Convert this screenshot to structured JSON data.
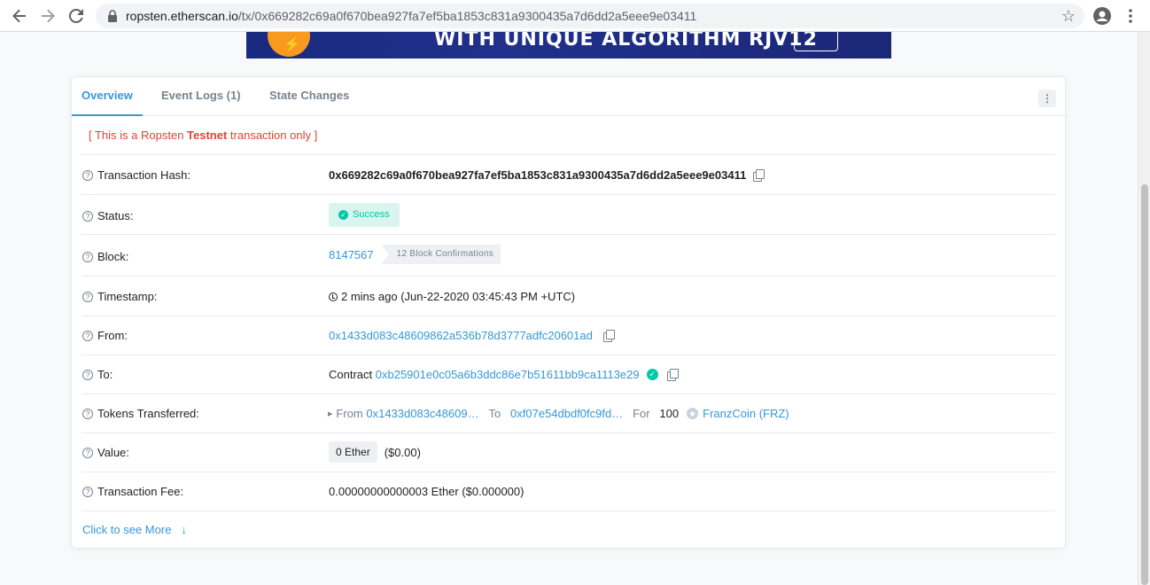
{
  "browser": {
    "url_host": "ropsten.etherscan.io",
    "url_path": "/tx/0x669282c69a0f670bea927fa7ef5ba1853c831a9300435a7d6dd2a5eee9e03411"
  },
  "tabs": [
    {
      "label": "Overview"
    },
    {
      "label": "Event Logs (1)"
    },
    {
      "label": "State Changes"
    }
  ],
  "notice": {
    "prefix": "[ This is a Ropsten ",
    "bold": "Testnet",
    "suffix": " transaction only ]"
  },
  "rows": {
    "tx_hash": {
      "label": "Transaction Hash:",
      "value": "0x669282c69a0f670bea927fa7ef5ba1853c831a9300435a7d6dd2a5eee9e03411"
    },
    "status": {
      "label": "Status:",
      "value": "Success"
    },
    "block": {
      "label": "Block:",
      "value": "8147567",
      "confirmations": "12 Block Confirmations"
    },
    "timestamp": {
      "label": "Timestamp:",
      "value": "2 mins ago (Jun-22-2020 03:45:43 PM +UTC)"
    },
    "from": {
      "label": "From:",
      "value": "0x1433d083c48609862a536b78d3777adfc20601ad"
    },
    "to": {
      "label": "To:",
      "prefix": "Contract",
      "value": "0xb25901e0c05a6b3ddc86e7b51611bb9ca1113e29"
    },
    "tokens": {
      "label": "Tokens Transferred:",
      "from_label": "From",
      "from": "0x1433d083c48609…",
      "to_label": "To",
      "to": "0xf07e54dbdf0fc9fd…",
      "for_label": "For",
      "amount": "100",
      "token": "FranzCoin (FRZ)"
    },
    "value": {
      "label": "Value:",
      "ether": "0 Ether",
      "usd": "($0.00)"
    },
    "fee": {
      "label": "Transaction Fee:",
      "value": "0.00000000000003 Ether ($0.000000)"
    }
  },
  "see_more": "Click to see More",
  "colors": {
    "accent": "#3498db",
    "success": "#00c9a7",
    "danger": "#de4437"
  }
}
